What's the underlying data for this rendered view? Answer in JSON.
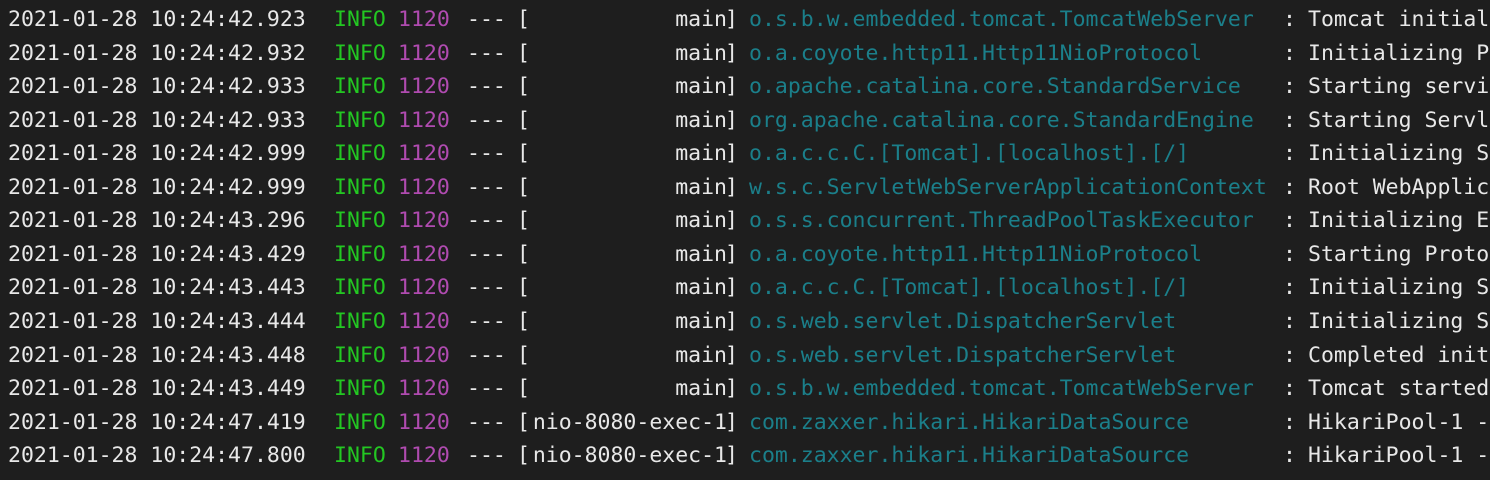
{
  "console": {
    "colors": {
      "background": "#1e1e1e",
      "text": "#e8e8e8",
      "level_info": "#23c722",
      "pid": "#b04bb0",
      "logger": "#1b7f8a"
    },
    "lines": [
      {
        "timestamp": "2021-01-28 10:24:42.923",
        "level": "INFO",
        "pid": "1120",
        "sep": "---",
        "thread": "main",
        "logger": "o.s.b.w.embedded.tomcat.TomcatWebServer",
        "message": "Tomcat initial"
      },
      {
        "timestamp": "2021-01-28 10:24:42.932",
        "level": "INFO",
        "pid": "1120",
        "sep": "---",
        "thread": "main",
        "logger": "o.a.coyote.http11.Http11NioProtocol",
        "message": "Initializing P"
      },
      {
        "timestamp": "2021-01-28 10:24:42.933",
        "level": "INFO",
        "pid": "1120",
        "sep": "---",
        "thread": "main",
        "logger": "o.apache.catalina.core.StandardService",
        "message": "Starting servi"
      },
      {
        "timestamp": "2021-01-28 10:24:42.933",
        "level": "INFO",
        "pid": "1120",
        "sep": "---",
        "thread": "main",
        "logger": "org.apache.catalina.core.StandardEngine",
        "message": "Starting Servl"
      },
      {
        "timestamp": "2021-01-28 10:24:42.999",
        "level": "INFO",
        "pid": "1120",
        "sep": "---",
        "thread": "main",
        "logger": "o.a.c.c.C.[Tomcat].[localhost].[/]",
        "message": "Initializing S"
      },
      {
        "timestamp": "2021-01-28 10:24:42.999",
        "level": "INFO",
        "pid": "1120",
        "sep": "---",
        "thread": "main",
        "logger": "w.s.c.ServletWebServerApplicationContext",
        "message": "Root WebApplic"
      },
      {
        "timestamp": "2021-01-28 10:24:43.296",
        "level": "INFO",
        "pid": "1120",
        "sep": "---",
        "thread": "main",
        "logger": "o.s.s.concurrent.ThreadPoolTaskExecutor",
        "message": "Initializing E"
      },
      {
        "timestamp": "2021-01-28 10:24:43.429",
        "level": "INFO",
        "pid": "1120",
        "sep": "---",
        "thread": "main",
        "logger": "o.a.coyote.http11.Http11NioProtocol",
        "message": "Starting Proto"
      },
      {
        "timestamp": "2021-01-28 10:24:43.443",
        "level": "INFO",
        "pid": "1120",
        "sep": "---",
        "thread": "main",
        "logger": "o.a.c.c.C.[Tomcat].[localhost].[/]",
        "message": "Initializing S"
      },
      {
        "timestamp": "2021-01-28 10:24:43.444",
        "level": "INFO",
        "pid": "1120",
        "sep": "---",
        "thread": "main",
        "logger": "o.s.web.servlet.DispatcherServlet",
        "message": "Initializing S"
      },
      {
        "timestamp": "2021-01-28 10:24:43.448",
        "level": "INFO",
        "pid": "1120",
        "sep": "---",
        "thread": "main",
        "logger": "o.s.web.servlet.DispatcherServlet",
        "message": "Completed init"
      },
      {
        "timestamp": "2021-01-28 10:24:43.449",
        "level": "INFO",
        "pid": "1120",
        "sep": "---",
        "thread": "main",
        "logger": "o.s.b.w.embedded.tomcat.TomcatWebServer",
        "message": "Tomcat started"
      },
      {
        "timestamp": "2021-01-28 10:24:47.419",
        "level": "INFO",
        "pid": "1120",
        "sep": "---",
        "thread": "nio-8080-exec-1",
        "logger": "com.zaxxer.hikari.HikariDataSource",
        "message": "HikariPool-1 -"
      },
      {
        "timestamp": "2021-01-28 10:24:47.800",
        "level": "INFO",
        "pid": "1120",
        "sep": "---",
        "thread": "nio-8080-exec-1",
        "logger": "com.zaxxer.hikari.HikariDataSource",
        "message": "HikariPool-1 -"
      }
    ]
  }
}
